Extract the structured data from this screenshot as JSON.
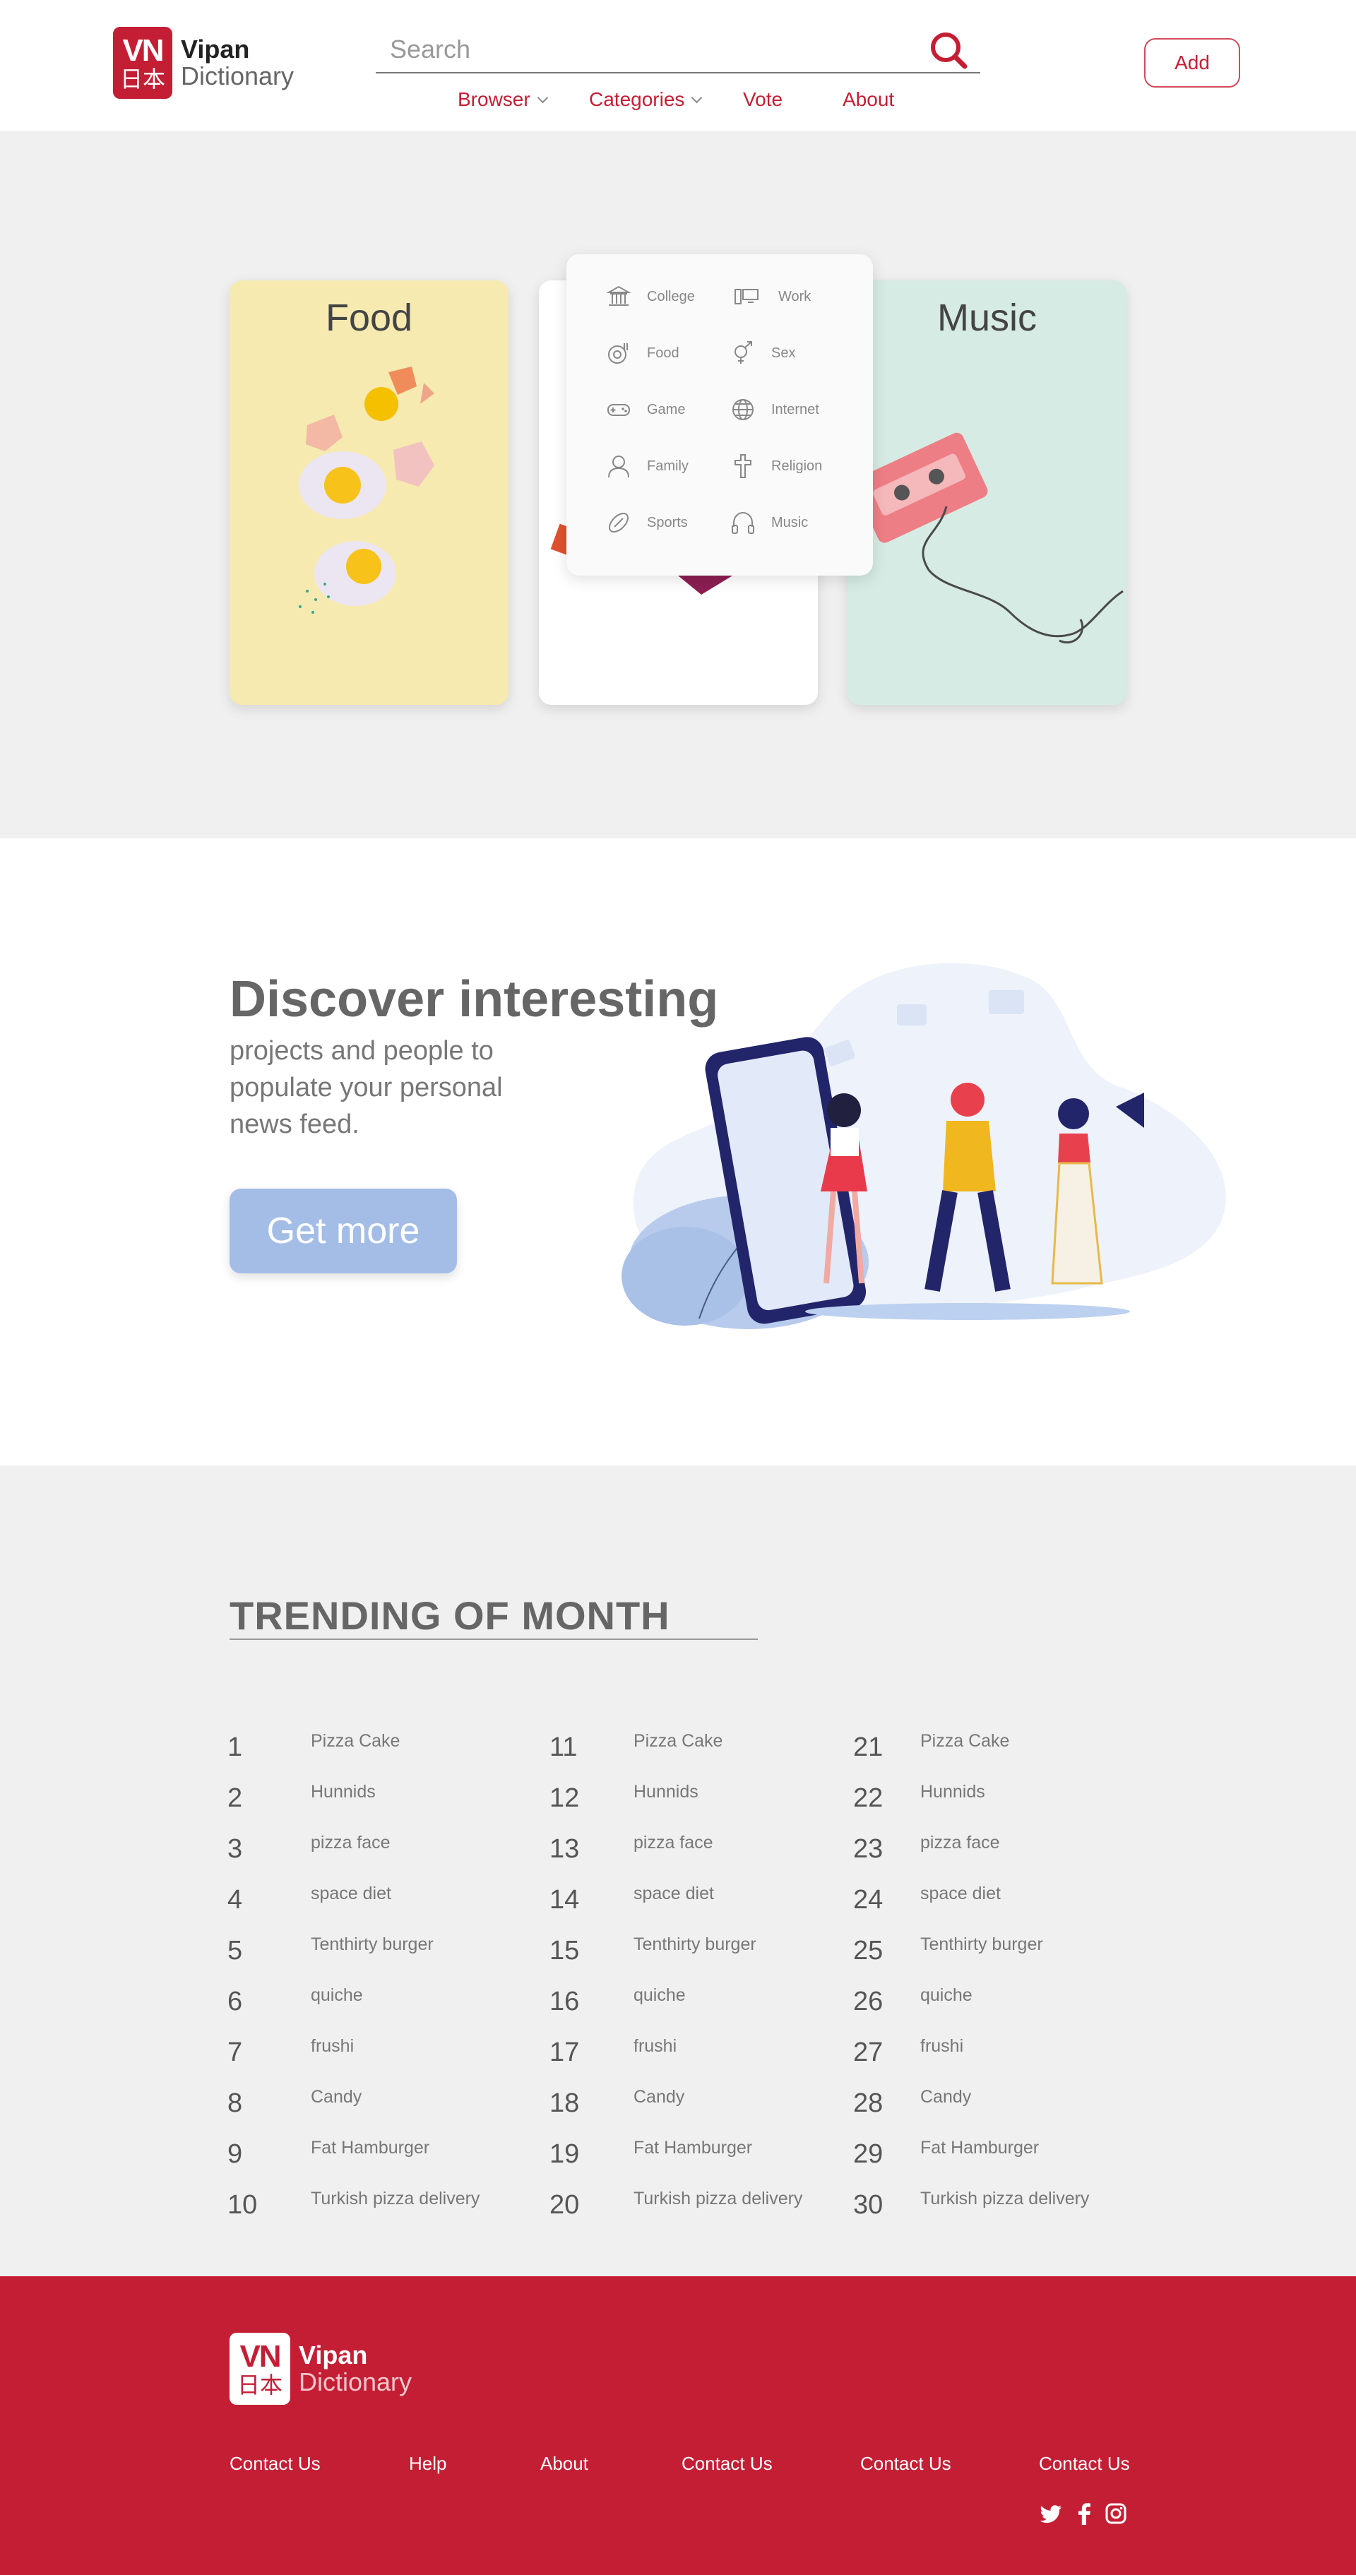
{
  "brand": {
    "mark_text": "VN",
    "mark_kanji": "日本",
    "name_line1": "Vipan",
    "name_line2": "Dictionary"
  },
  "header": {
    "search_placeholder": "Search",
    "add_label": "Add",
    "nav": [
      {
        "label": "Browser",
        "has_chevron": true
      },
      {
        "label": "Categories",
        "has_chevron": true
      },
      {
        "label": "Vote",
        "has_chevron": false
      },
      {
        "label": "About",
        "has_chevron": false
      }
    ]
  },
  "categories_menu": [
    {
      "label": "College",
      "icon": "college-icon"
    },
    {
      "label": "Work",
      "icon": "work-icon"
    },
    {
      "label": "Food",
      "icon": "food-icon"
    },
    {
      "label": "Sex",
      "icon": "sex-icon"
    },
    {
      "label": "Game",
      "icon": "gamepad-icon"
    },
    {
      "label": "Internet",
      "icon": "globe-icon"
    },
    {
      "label": "Family",
      "icon": "person-icon"
    },
    {
      "label": "Religion",
      "icon": "cross-icon"
    },
    {
      "label": "Sports",
      "icon": "football-icon"
    },
    {
      "label": "Music",
      "icon": "headphones-icon"
    }
  ],
  "cards": [
    {
      "title": "Food"
    },
    {
      "title": ""
    },
    {
      "title": "Music"
    }
  ],
  "discover": {
    "title": "Discover interesting",
    "subtitle": "projects and people to populate your personal news feed.",
    "button_label": "Get more"
  },
  "trending": {
    "title": "TRENDING OF MONTH",
    "items": [
      {
        "rank": "1",
        "name": "Pizza Cake"
      },
      {
        "rank": "2",
        "name": "Hunnids"
      },
      {
        "rank": "3",
        "name": "pizza face"
      },
      {
        "rank": "4",
        "name": "space diet"
      },
      {
        "rank": "5",
        "name": "Tenthirty burger"
      },
      {
        "rank": "6",
        "name": "quiche"
      },
      {
        "rank": "7",
        "name": "frushi"
      },
      {
        "rank": "8",
        "name": "Candy"
      },
      {
        "rank": "9",
        "name": "Fat Hamburger"
      },
      {
        "rank": "10",
        "name": "Turkish pizza delivery"
      },
      {
        "rank": "11",
        "name": "Pizza Cake"
      },
      {
        "rank": "12",
        "name": "Hunnids"
      },
      {
        "rank": "13",
        "name": "pizza face"
      },
      {
        "rank": "14",
        "name": "space diet"
      },
      {
        "rank": "15",
        "name": "Tenthirty burger"
      },
      {
        "rank": "16",
        "name": "quiche"
      },
      {
        "rank": "17",
        "name": "frushi"
      },
      {
        "rank": "18",
        "name": "Candy"
      },
      {
        "rank": "19",
        "name": "Fat Hamburger"
      },
      {
        "rank": "20",
        "name": "Turkish pizza delivery"
      },
      {
        "rank": "21",
        "name": "Pizza Cake"
      },
      {
        "rank": "22",
        "name": "Hunnids"
      },
      {
        "rank": "23",
        "name": "pizza face"
      },
      {
        "rank": "24",
        "name": "space diet"
      },
      {
        "rank": "25",
        "name": "Tenthirty burger"
      },
      {
        "rank": "26",
        "name": "quiche"
      },
      {
        "rank": "27",
        "name": "frushi"
      },
      {
        "rank": "28",
        "name": "Candy"
      },
      {
        "rank": "29",
        "name": "Fat Hamburger"
      },
      {
        "rank": "30",
        "name": "Turkish pizza delivery"
      }
    ]
  },
  "footer": {
    "links": [
      "Contact Us",
      "Help",
      "About",
      "Contact Us",
      "Contact Us",
      "Contact Us"
    ],
    "social": [
      "twitter-icon",
      "facebook-icon",
      "instagram-icon"
    ]
  },
  "colors": {
    "brand_red": "#c41e35",
    "section_gray": "#f0f0f0",
    "button_blue": "#a3bde6"
  }
}
